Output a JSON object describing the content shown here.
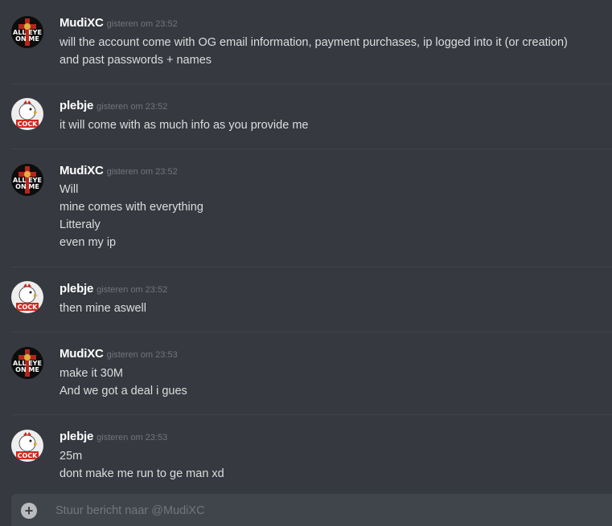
{
  "composer": {
    "placeholder": "Stuur bericht naar @MudiXC",
    "add_icon": "plus-circle-icon"
  },
  "avatars": {
    "mudixc": {
      "text_top": "ALL EYE",
      "text_bottom": "ON ME",
      "icon": "cross-avatar-icon"
    },
    "plebje": {
      "text": "COCK",
      "icon": "rooster-avatar-icon"
    }
  },
  "messages": [
    {
      "author": "MudiXC",
      "timestamp": "gisteren om 23:52",
      "lines": [
        "will the account come with OG email information, payment purchases, ip logged into it (or creation)",
        "and past passwords + names"
      ]
    },
    {
      "author": "plebje",
      "timestamp": "gisteren om 23:52",
      "lines": [
        "it will come with as much info as you provide me"
      ]
    },
    {
      "author": "MudiXC",
      "timestamp": "gisteren om 23:52",
      "lines": [
        "Will",
        "mine comes with everything",
        "Litteraly",
        "even my ip"
      ]
    },
    {
      "author": "plebje",
      "timestamp": "gisteren om 23:52",
      "lines": [
        "then mine aswell"
      ]
    },
    {
      "author": "MudiXC",
      "timestamp": "gisteren om 23:53",
      "lines": [
        "make it 30M",
        "And we got a deal i gues"
      ]
    },
    {
      "author": "plebje",
      "timestamp": "gisteren om 23:53",
      "lines": [
        "25m",
        "dont make me run to ge man xd"
      ]
    }
  ]
}
